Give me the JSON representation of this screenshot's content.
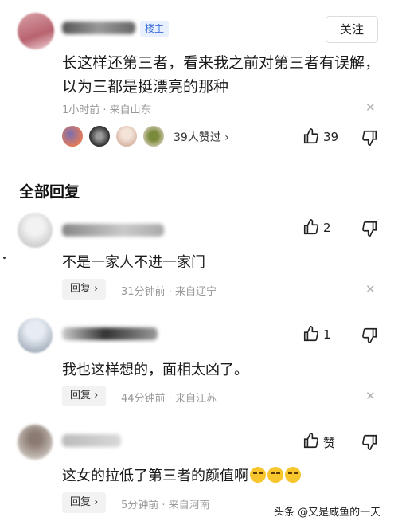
{
  "post": {
    "author_badge": "楼主",
    "follow_label": "关注",
    "text": "长这样还第三者，看来我之前对第三者有误解，以为三都是挺漂亮的那种",
    "meta": "1小时前 · 来自山东",
    "likers_label": "39人赞过 ›",
    "like_count": "39"
  },
  "section_title": "全部回复",
  "replies": [
    {
      "text": "不是一家人不进一家门",
      "reply_label": "回复 ›",
      "meta": "31分钟前 · 来自辽宁",
      "like_count": "2"
    },
    {
      "text": "我也这样想的，面相太凶了。",
      "reply_label": "回复 ›",
      "meta": "44分钟前 · 来自江苏",
      "like_count": "1"
    },
    {
      "text": "这女的拉低了第三者的颜值啊",
      "reply_label": "回复 ›",
      "meta": "5分钟前 · 来自河南",
      "like_count": "赞"
    }
  ],
  "watermark": "头条 @又是咸鱼的一天",
  "colors": {
    "badge_bg": "#e8f0ff",
    "badge_text": "#3b6fd8",
    "meta_gray": "#999999"
  }
}
